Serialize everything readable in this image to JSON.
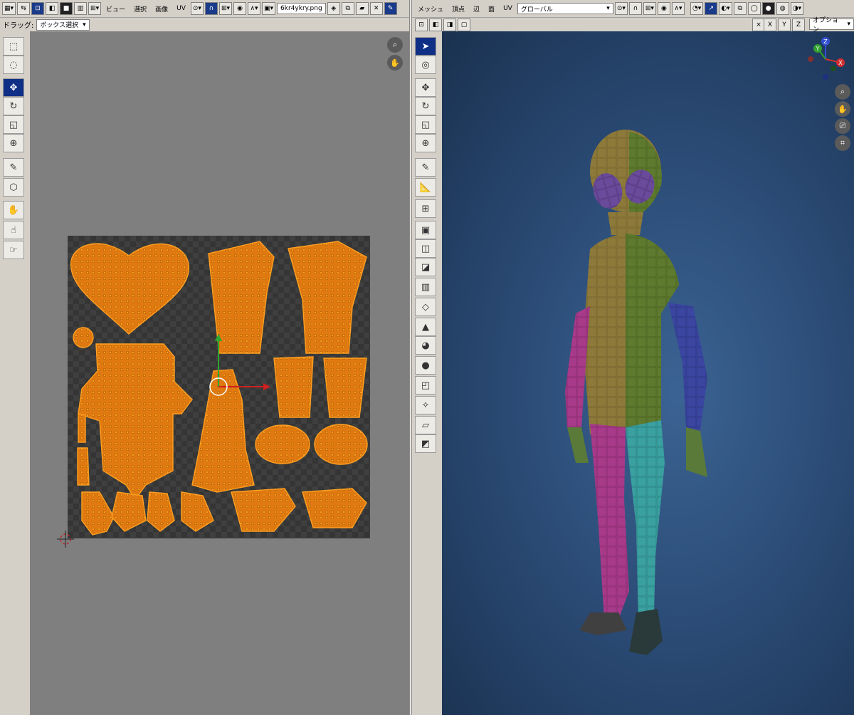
{
  "uv_header": {
    "menus": [
      "ビュー",
      "選択",
      "画像",
      "UV"
    ],
    "image_name": "6kr4ykry.png"
  },
  "uv_subheader": {
    "drag_label": "ドラッグ:",
    "drag_value": "ボックス選択"
  },
  "view3d_header": {
    "menus": [
      "メッシュ",
      "頂点",
      "辺",
      "面",
      "UV"
    ],
    "transform_orientation": "グローバル",
    "axes": [
      "X",
      "Y",
      "Z"
    ],
    "options_label": "オプション"
  },
  "gizmo": {
    "labels": [
      "Z",
      "Y",
      "X"
    ]
  }
}
